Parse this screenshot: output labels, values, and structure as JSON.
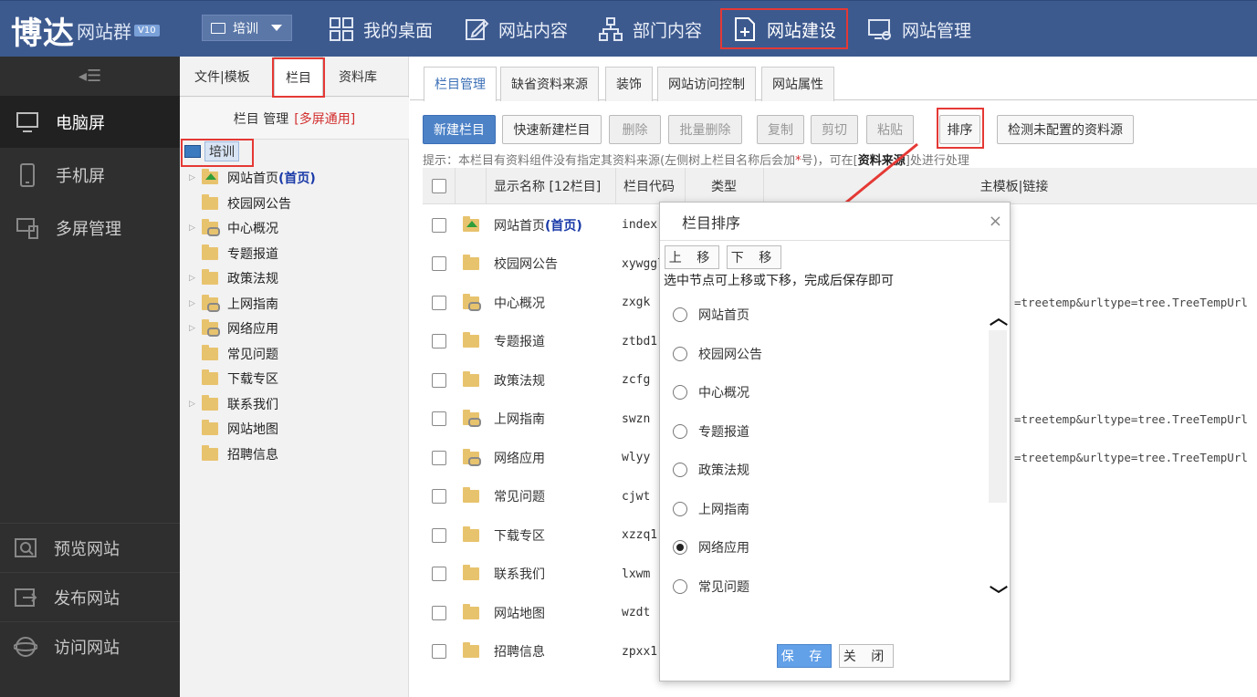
{
  "brand": {
    "name_big": "博达",
    "name_small": "网站群",
    "version": "V10"
  },
  "site_selector": {
    "value": "培训"
  },
  "top_nav": [
    {
      "label": "我的桌面",
      "icon": "desktop-grid-icon"
    },
    {
      "label": "网站内容",
      "icon": "edit-icon"
    },
    {
      "label": "部门内容",
      "icon": "org-chart-icon"
    },
    {
      "label": "网站建设",
      "icon": "page-add-icon"
    },
    {
      "label": "网站管理",
      "icon": "site-settings-icon"
    }
  ],
  "sidebar": {
    "items": [
      {
        "label": "电脑屏",
        "icon": "monitor-icon"
      },
      {
        "label": "手机屏",
        "icon": "mobile-icon"
      },
      {
        "label": "多屏管理",
        "icon": "multi-screen-icon"
      }
    ],
    "bottom": [
      {
        "label": "预览网站",
        "icon": "preview-icon"
      },
      {
        "label": "发布网站",
        "icon": "publish-icon"
      },
      {
        "label": "访问网站",
        "icon": "globe-icon"
      }
    ]
  },
  "tree_panel": {
    "tabs": [
      "文件|模板",
      "栏目",
      "资料库"
    ],
    "title": "栏目 管理",
    "title_tag": "[多屏通用]",
    "root": "培训",
    "nodes": [
      {
        "label": "网站首页",
        "tag": "(首页)"
      },
      {
        "label": "校园网公告",
        "tag": ""
      },
      {
        "label": "中心概况",
        "tag": ""
      },
      {
        "label": "专题报道",
        "tag": ""
      },
      {
        "label": "政策法规",
        "tag": ""
      },
      {
        "label": "上网指南",
        "tag": ""
      },
      {
        "label": "网络应用",
        "tag": ""
      },
      {
        "label": "常见问题",
        "tag": ""
      },
      {
        "label": "下载专区",
        "tag": ""
      },
      {
        "label": "联系我们",
        "tag": ""
      },
      {
        "label": "网站地图",
        "tag": ""
      },
      {
        "label": "招聘信息",
        "tag": ""
      }
    ]
  },
  "main": {
    "tabs": [
      "栏目管理",
      "缺省资料来源",
      "装饰",
      "网站访问控制",
      "网站属性"
    ],
    "toolbar": [
      "新建栏目",
      "快速新建栏目",
      "删除",
      "批量删除",
      "复制",
      "剪切",
      "粘贴",
      "排序",
      "检测未配置的资料源"
    ],
    "hint_pre": "提示：本栏目有资料组件没有指定其资料来源(左侧树上栏目名称后会加",
    "hint_star": "*",
    "hint_mid": "号)，可在[",
    "hint_bold": "资料来源",
    "hint_post": "]处进行处理",
    "columns": [
      "显示名称 [12栏目]",
      "栏目代码",
      "类型",
      "主模板|链接"
    ],
    "rows": [
      {
        "name": "网站首页",
        "tag": "(首页)",
        "code": "index",
        "url": ""
      },
      {
        "name": "校园网公告",
        "tag": "",
        "code": "xywggl",
        "url": ""
      },
      {
        "name": "中心概况",
        "tag": "",
        "code": "zxgk",
        "url": "=treetemp&urltype=tree.TreeTempUrl"
      },
      {
        "name": "专题报道",
        "tag": "",
        "code": "ztbd1",
        "url": ""
      },
      {
        "name": "政策法规",
        "tag": "",
        "code": "zcfg",
        "url": ""
      },
      {
        "name": "上网指南",
        "tag": "",
        "code": "swzn",
        "url": "=treetemp&urltype=tree.TreeTempUrl"
      },
      {
        "name": "网络应用",
        "tag": "",
        "code": "wlyy",
        "url": "=treetemp&urltype=tree.TreeTempUrl"
      },
      {
        "name": "常见问题",
        "tag": "",
        "code": "cjwt",
        "url": ""
      },
      {
        "name": "下载专区",
        "tag": "",
        "code": "xzzq1",
        "url": ""
      },
      {
        "name": "联系我们",
        "tag": "",
        "code": "lxwm",
        "url": ""
      },
      {
        "name": "网站地图",
        "tag": "",
        "code": "wzdt",
        "url": ""
      },
      {
        "name": "招聘信息",
        "tag": "",
        "code": "zpxx1",
        "url": ""
      }
    ]
  },
  "dialog": {
    "title": "栏目排序",
    "close": "×",
    "move_up": "上 移",
    "move_down": "下 移",
    "tip": "选中节点可上移或下移，完成后保存即可",
    "items": [
      "网站首页",
      "校园网公告",
      "中心概况",
      "专题报道",
      "政策法规",
      "上网指南",
      "网络应用",
      "常见问题"
    ],
    "selected_index": 6,
    "save": "保 存",
    "close_btn": "关 闭"
  },
  "colors": {
    "topbar": "#3d5a8f",
    "accent": "#4d82c7",
    "highlight": "#e53935"
  }
}
